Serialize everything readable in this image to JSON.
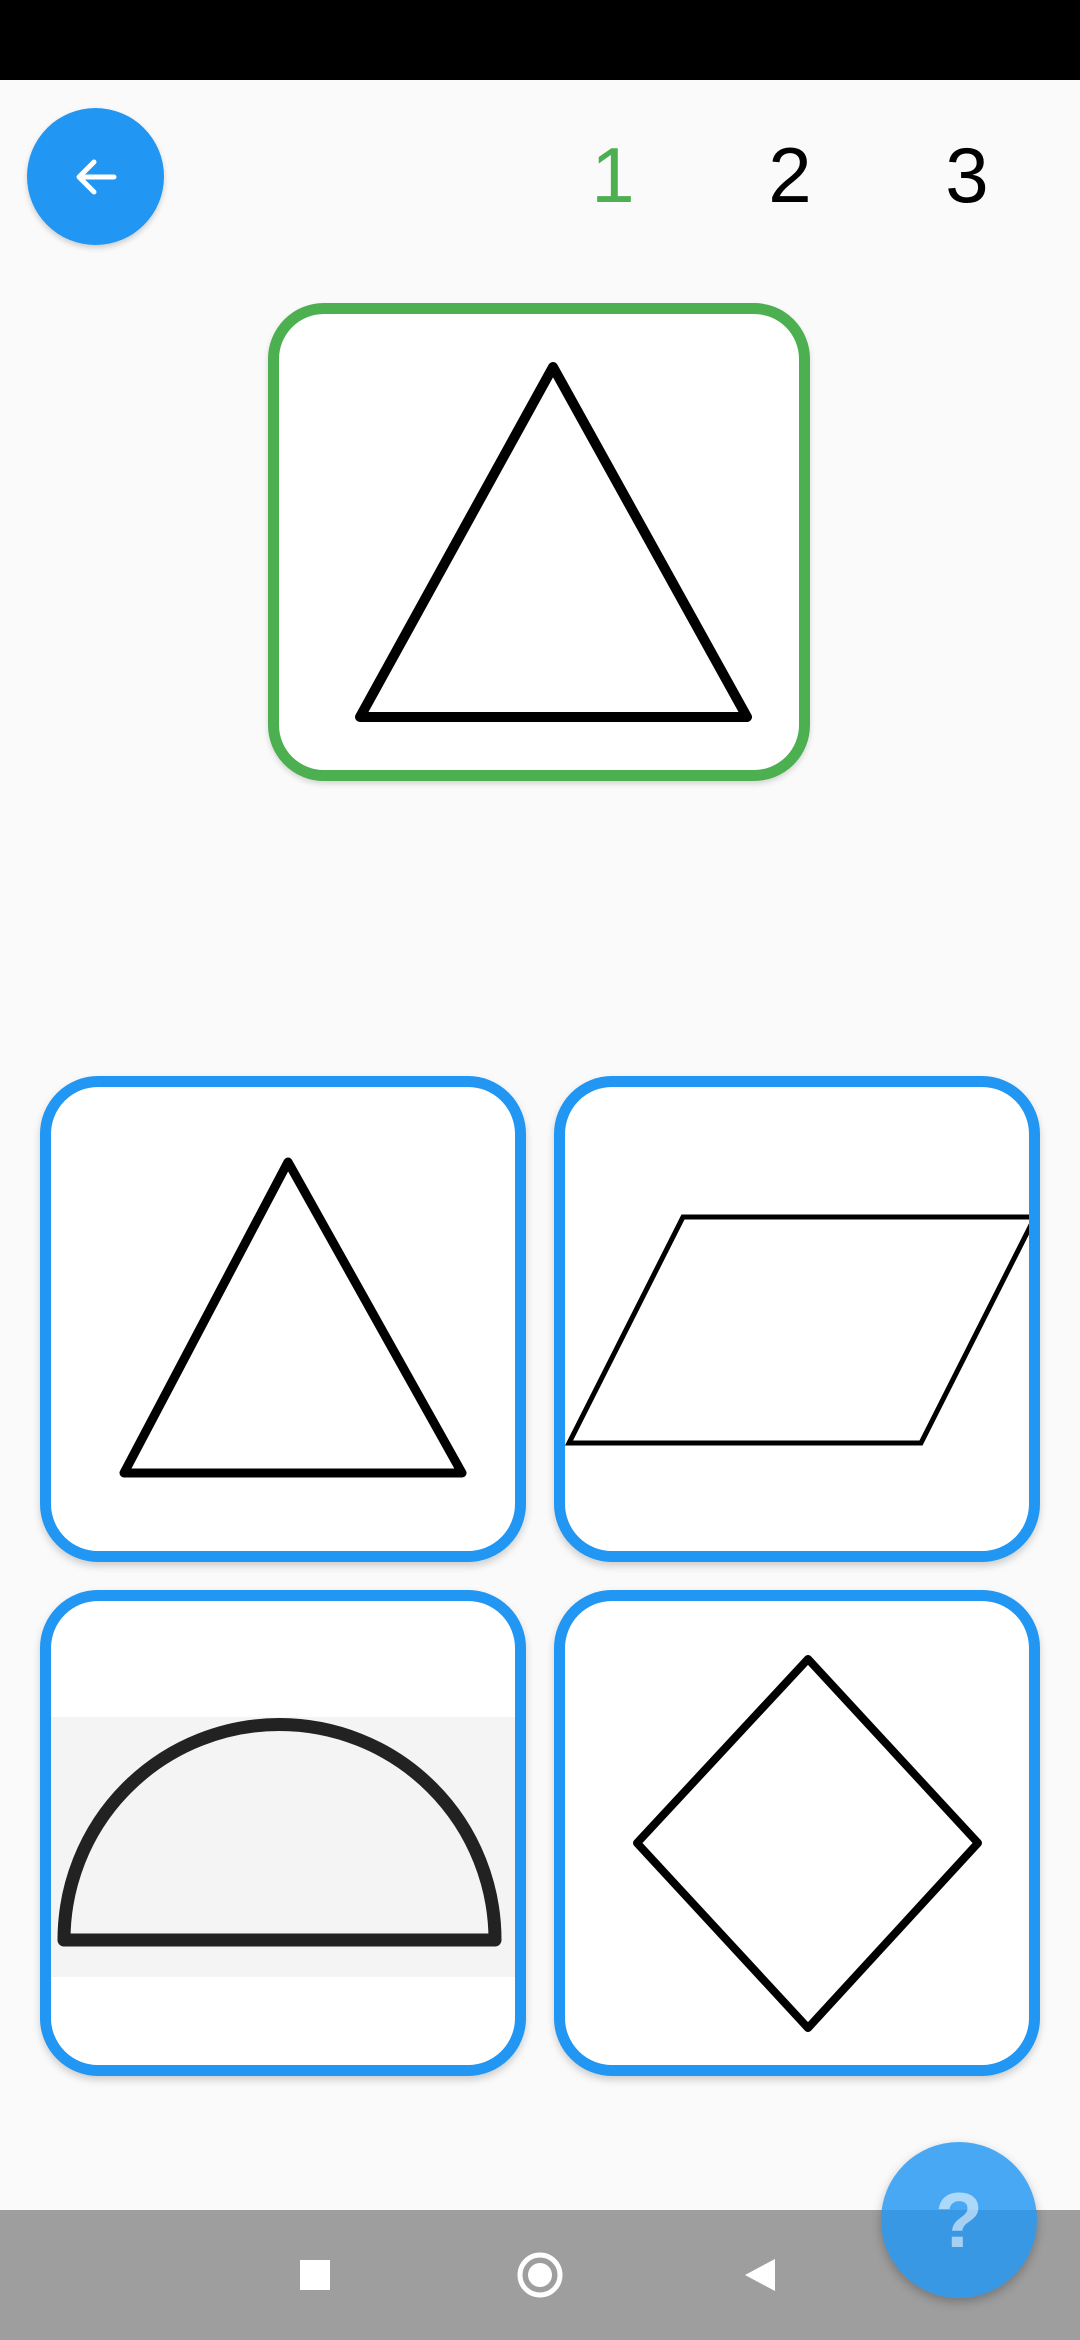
{
  "header": {
    "back_icon": "arrow-left-icon",
    "steps": [
      {
        "label": "1",
        "active": true
      },
      {
        "label": "2",
        "active": false
      },
      {
        "label": "3",
        "active": false
      }
    ],
    "active_color": "#4caf50"
  },
  "target": {
    "shape": "triangle",
    "border_color": "#4caf50"
  },
  "options": [
    {
      "shape": "triangle"
    },
    {
      "shape": "parallelogram"
    },
    {
      "shape": "semicircle"
    },
    {
      "shape": "diamond"
    }
  ],
  "colors": {
    "accent": "#2196f3",
    "correct": "#4caf50",
    "background": "#fafafa"
  },
  "help_button": {
    "label": "?"
  },
  "system_nav": {
    "items": [
      "recents-square-icon",
      "home-circle-icon",
      "back-triangle-icon"
    ]
  }
}
